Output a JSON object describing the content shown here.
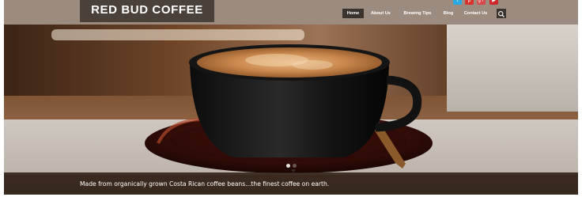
{
  "brand": {
    "name": "RED BUD COFFEE"
  },
  "nav": {
    "items": [
      {
        "label": "Home",
        "active": true
      },
      {
        "label": "About Us",
        "active": false
      },
      {
        "label": "Brewing Tips",
        "active": false
      },
      {
        "label": "Blog",
        "active": false
      },
      {
        "label": "Contact Us",
        "active": false
      }
    ],
    "search_icon": "search-icon"
  },
  "social": [
    {
      "name": "twitter-icon",
      "glyph": "t",
      "color": "#29a9e1"
    },
    {
      "name": "pinterest-icon",
      "glyph": "p",
      "color": "#d6332f"
    },
    {
      "name": "google-plus-icon",
      "glyph": "g+",
      "color": "#d6484a"
    },
    {
      "name": "youtube-icon",
      "glyph": "▶",
      "color": "#cc2a2a"
    }
  ],
  "hero": {
    "caption": "Made from organically grown Costa Rican coffee beans...the finest coffee on earth.",
    "slides": 2,
    "active_slide": 1
  },
  "colors": {
    "header_bg": "#9c8b7f",
    "logo_bg": "#4a413a",
    "nav_active_bg": "#3b332d",
    "caption_bg": "#34261c"
  }
}
